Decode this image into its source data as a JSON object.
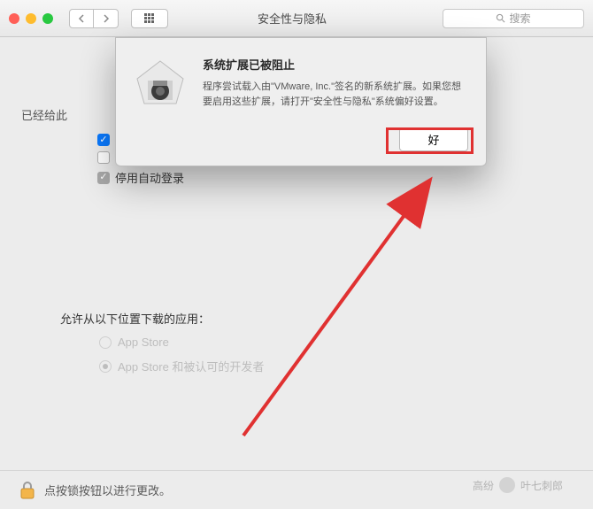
{
  "window": {
    "title": "安全性与隐私",
    "search_placeholder": "搜索"
  },
  "main": {
    "section1_label_prefix": "已经给此",
    "checkboxes": [
      {
        "label": "",
        "state": "blue"
      },
      {
        "label": "",
        "state": "empty"
      },
      {
        "label": "停用自动登录",
        "state": "grey"
      }
    ],
    "section2_label": "允许从以下位置下载的应用：",
    "radios": [
      {
        "label": "App Store",
        "selected": false
      },
      {
        "label": "App Store 和被认可的开发者",
        "selected": true
      }
    ]
  },
  "footer": {
    "text": "点按锁按钮以进行更改。"
  },
  "dialog": {
    "title": "系统扩展已被阻止",
    "body": "程序尝试载入由\"VMware, Inc.\"签名的新系统扩展。如果您想要启用这些扩展，请打开\"安全性与隐私\"系统偏好设置。",
    "ok_label": "好"
  },
  "watermark": {
    "text": "叶七刺郎",
    "prefix": "高纷"
  }
}
